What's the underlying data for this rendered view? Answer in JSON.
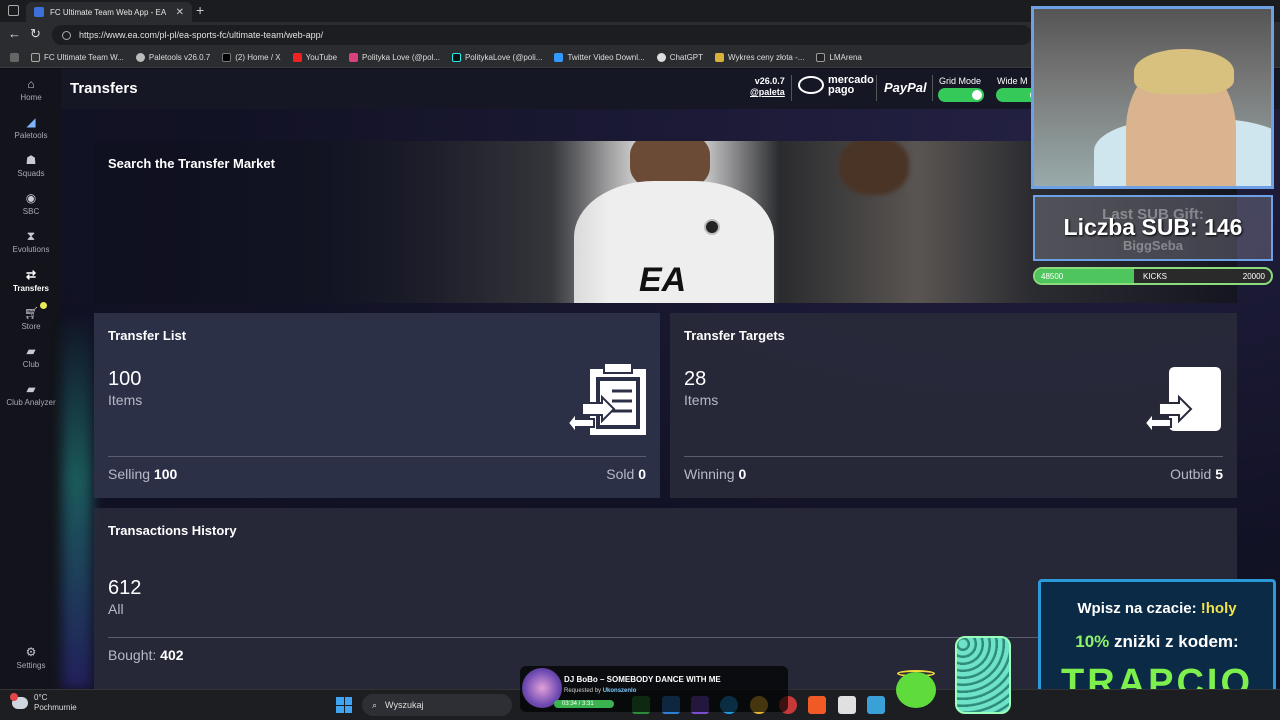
{
  "browser": {
    "tab_title": "FC Ultimate Team Web App - EA",
    "url": "https://www.ea.com/pl-pl/ea-sports-fc/ultimate-team/web-app/",
    "bookmarks": [
      "FC Ultimate Team W...",
      "Paletools v26.0.7",
      "(2) Home / X",
      "YouTube",
      "Polityka Love (@pol...",
      "PolitykaLove (@poli...",
      "Twitter Video Downl...",
      "ChatGPT",
      "Wykres ceny złota -...",
      "LMArena"
    ]
  },
  "sidenav": {
    "items": [
      {
        "label": "Home",
        "icon": "home-icon"
      },
      {
        "label": "Paletools",
        "icon": "paletools-icon"
      },
      {
        "label": "Squads",
        "icon": "squads-icon"
      },
      {
        "label": "SBC",
        "icon": "sbc-icon"
      },
      {
        "label": "Evolutions",
        "icon": "evolutions-icon"
      },
      {
        "label": "Transfers",
        "icon": "transfers-icon"
      },
      {
        "label": "Store",
        "icon": "cart-icon"
      },
      {
        "label": "Club",
        "icon": "club-icon"
      },
      {
        "label": "Club Analyzer",
        "icon": "club-analyzer-icon"
      },
      {
        "label": "Settings",
        "icon": "gear-icon"
      }
    ]
  },
  "header": {
    "title": "Transfers",
    "version": "v26.0.7",
    "author": "@paleta",
    "mercado": "mercado pago",
    "paypal": "PayPal",
    "grid_mode": "Grid Mode",
    "wide_mode": "Wide M"
  },
  "hero": {
    "title": "Search the Transfer Market"
  },
  "transfer_list": {
    "title": "Transfer List",
    "count": "100",
    "unit": "Items",
    "left_label": "Selling",
    "left_value": "100",
    "right_label": "Sold",
    "right_value": "0"
  },
  "transfer_targets": {
    "title": "Transfer Targets",
    "count": "28",
    "unit": "Items",
    "left_label": "Winning",
    "left_value": "0",
    "right_label": "Outbid",
    "right_value": "5"
  },
  "transactions": {
    "title": "Transactions History",
    "count": "612",
    "unit": "All",
    "left_label": "Bought:",
    "left_value": "402"
  },
  "overlay": {
    "subs_ghost_top": "Last SUB Gift:",
    "subs_main": "Liczba SUB: 146",
    "subs_ghost_bottom": "BiggSeba",
    "kicks_left": "48500",
    "kicks_mid": "KICKS",
    "kicks_right": "20000",
    "kicks_progress": 0.42,
    "promo_l1_a": "Wpisz na czacie: ",
    "promo_l1_b": "!holy",
    "promo_l2_a": "10%",
    "promo_l2_b": " zniżki z kodem:",
    "promo_code": "TRAPCIO"
  },
  "now_playing": {
    "title": "DJ BoBo – SOMEBODY DANCE WITH ME",
    "requested_prefix": "Requested by ",
    "requested_by": "Ukonszenlo",
    "time": "03:34 / 3:31"
  },
  "taskbar": {
    "temp": "0°C",
    "weather": "Pochmurnie",
    "search_placeholder": "Wyszukaj"
  },
  "colors": {
    "toggle_on": "#35c95a",
    "accent": "#6ea0e6",
    "promo_green": "#7df04e"
  }
}
